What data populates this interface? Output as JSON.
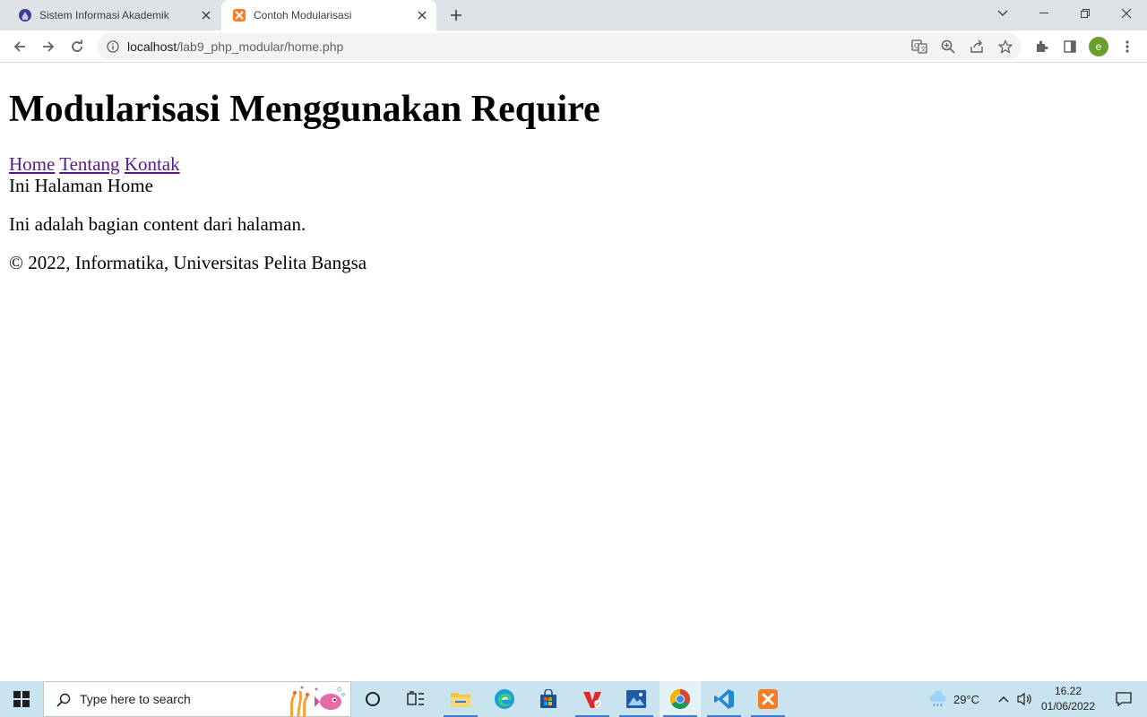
{
  "browser": {
    "tabs": [
      {
        "title": "Sistem Informasi Akademik",
        "active": false,
        "icon": "university-icon"
      },
      {
        "title": "Contoh Modularisasi",
        "active": true,
        "icon": "xampp-icon"
      }
    ],
    "url_host": "localhost",
    "url_path": "/lab9_php_modular/home.php",
    "profile_initial": "e"
  },
  "page": {
    "heading": "Modularisasi Menggunakan Require",
    "nav": [
      {
        "label": "Home"
      },
      {
        "label": "Tentang"
      },
      {
        "label": "Kontak"
      }
    ],
    "section_title": "Ini Halaman Home",
    "content": "Ini adalah bagian content dari halaman.",
    "footer": "© 2022, Informatika, Universitas Pelita Bangsa"
  },
  "taskbar": {
    "search_placeholder": "Type here to search",
    "weather": "29°C",
    "time": "16.22",
    "date": "01/06/2022"
  },
  "colors": {
    "link": "#551a8b",
    "tabstrip": "#dee1e6",
    "taskbar": "#c9e3ef"
  }
}
